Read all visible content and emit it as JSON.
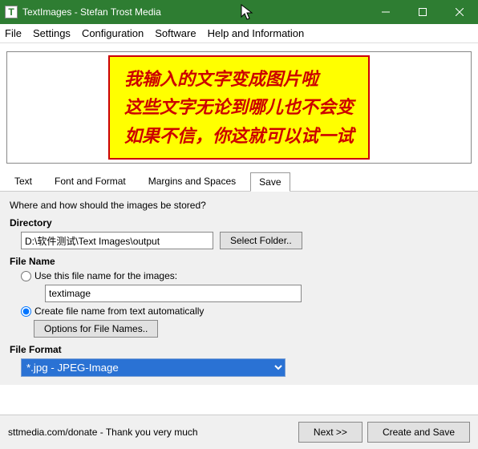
{
  "window": {
    "title": "TextImages - Stefan Trost Media",
    "icon_letter": "T"
  },
  "menu": {
    "file": "File",
    "settings": "Settings",
    "configuration": "Configuration",
    "software": "Software",
    "help": "Help and Information"
  },
  "preview": {
    "line1": "我输入的文字变成图片啦",
    "line2": "这些文字无论到哪儿也不会变",
    "line3": "如果不信，你这就可以试一试"
  },
  "tabs": {
    "text": "Text",
    "font": "Font and Format",
    "margins": "Margins and Spaces",
    "save": "Save"
  },
  "save": {
    "prompt": "Where and how should the images be stored?",
    "directory_label": "Directory",
    "directory_value": "D:\\软件测试\\Text Images\\output",
    "select_folder": "Select Folder..",
    "filename_label": "File Name",
    "use_filename_label": "Use this file name for the images:",
    "filename_value": "textimage",
    "auto_filename_label": "Create file name from text automatically",
    "options_btn": "Options for File Names..",
    "fileformat_label": "File Format",
    "fileformat_value": "*.jpg - JPEG-Image"
  },
  "footer": {
    "donate": "sttmedia.com/donate - Thank you very much",
    "next": "Next >>",
    "create": "Create and Save"
  }
}
